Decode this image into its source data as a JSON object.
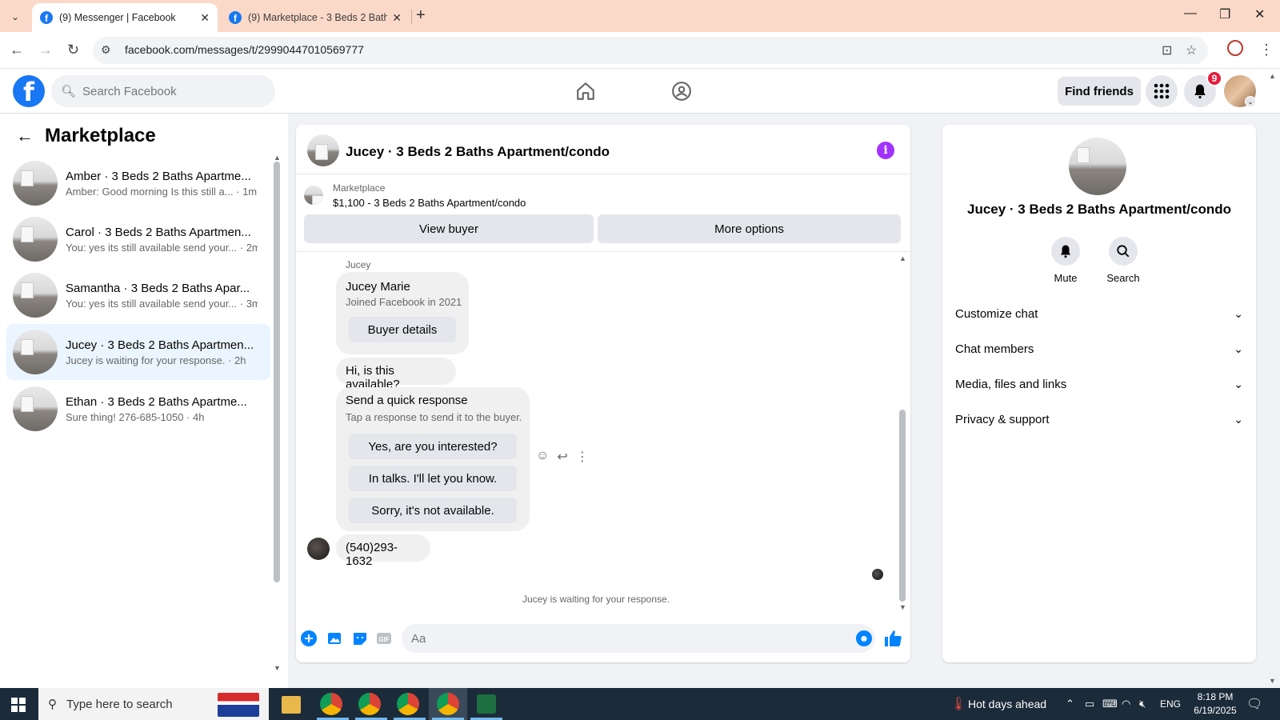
{
  "browser": {
    "tabs": [
      {
        "title": "(9) Messenger | Facebook",
        "active": true
      },
      {
        "title": "(9) Marketplace - 3 Beds 2 Bath",
        "active": false
      }
    ],
    "url": "facebook.com/messages/t/29990447010569777"
  },
  "header": {
    "search_placeholder": "Search Facebook",
    "find_friends": "Find friends",
    "notification_count": "9"
  },
  "sidebar": {
    "title": "Marketplace",
    "conversations": [
      {
        "name": "Amber · 3 Beds 2 Baths Apartme...",
        "preview": "Amber: Good morning Is this still a... · 1m"
      },
      {
        "name": "Carol · 3 Beds 2 Baths Apartmen...",
        "preview": "You: yes its still available send your... · 2m"
      },
      {
        "name": "Samantha · 3 Beds 2 Baths Apar...",
        "preview": "You: yes its still available send your... · 3m"
      },
      {
        "name": "Jucey · 3 Beds 2 Baths Apartmen...",
        "preview": "Jucey is waiting for your response. · 2h",
        "selected": true
      },
      {
        "name": "Ethan · 3 Beds 2 Baths Apartme...",
        "preview": "Sure thing! 276-685-1050 · 4h"
      }
    ]
  },
  "chat": {
    "title": "Jucey · 3 Beds 2 Baths Apartment/condo",
    "marketplace_label": "Marketplace",
    "listing": "$1,100 - 3 Beds 2 Baths Apartment/condo",
    "view_buyer": "View buyer",
    "more_options": "More options",
    "sender": "Jucey",
    "buyer_name": "Jucey Marie",
    "buyer_joined": "Joined Facebook in 2021",
    "buyer_details": "Buyer details",
    "message1": "Hi, is this available?",
    "quick_title": "Send a quick response",
    "quick_sub": "Tap a response to send it to the buyer.",
    "quick_responses": [
      "Yes, are you interested?",
      "In talks. I'll let you know.",
      "Sorry, it's not available."
    ],
    "message2": "(540)293-1632",
    "waiting": "Jucey is waiting for your response.",
    "composer_placeholder": "Aa"
  },
  "details": {
    "title": "Jucey · 3 Beds 2 Baths Apartment/condo",
    "mute": "Mute",
    "search": "Search",
    "sections": [
      "Customize chat",
      "Chat members",
      "Media, files and links",
      "Privacy & support"
    ]
  },
  "taskbar": {
    "search_placeholder": "Type here to search",
    "weather": "Hot days ahead",
    "lang": "ENG",
    "time": "8:18 PM",
    "date": "6/19/2025"
  }
}
